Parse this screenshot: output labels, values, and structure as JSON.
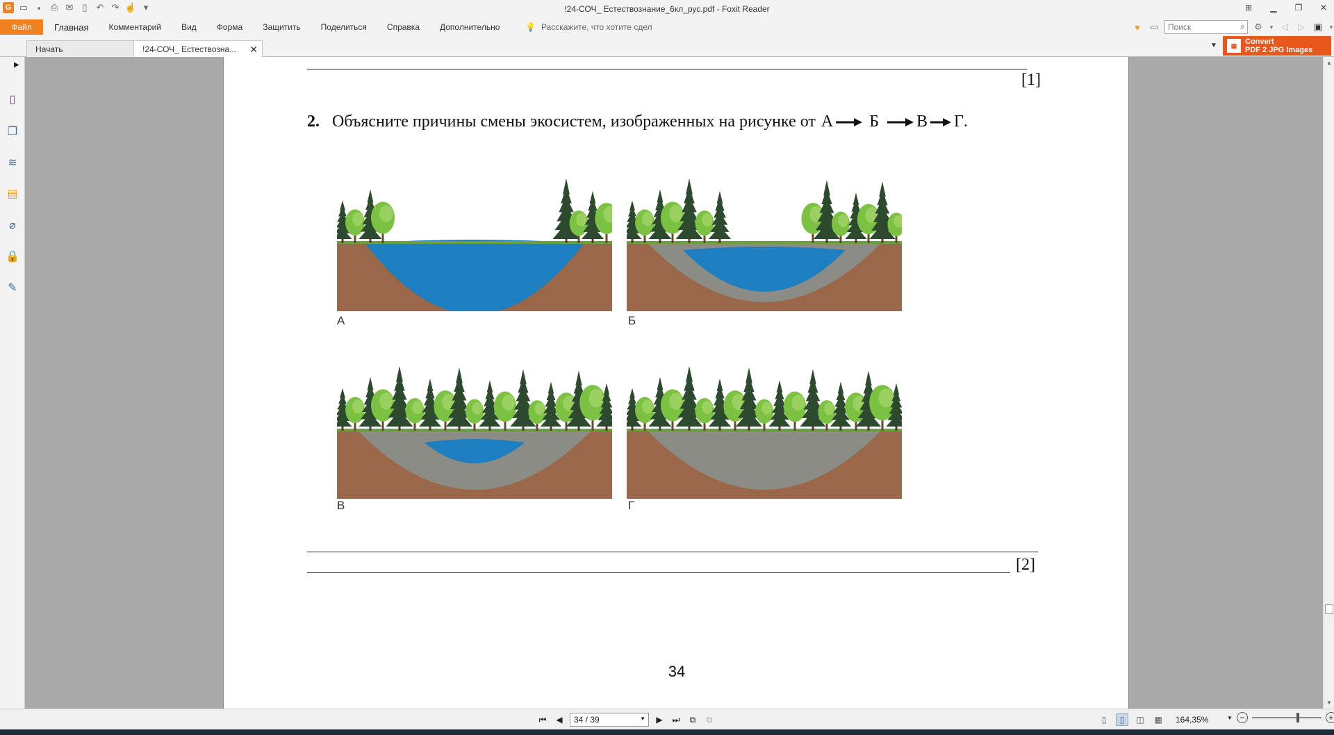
{
  "window": {
    "title": "!24-СОЧ_ Естествознание_6кл_рус.pdf - Foxit Reader",
    "logo": "G"
  },
  "menu": {
    "file": "Файл",
    "items": [
      "Главная",
      "Комментарий",
      "Вид",
      "Форма",
      "Защитить",
      "Поделиться",
      "Справка",
      "Дополнительно"
    ],
    "tell_me": "Расскажите, что хотите сдел",
    "search_placeholder": "Поиск"
  },
  "tabs": [
    {
      "label": "Начать"
    },
    {
      "label": "!24-СОЧ_ Естествозна..."
    }
  ],
  "convert": {
    "line1": "Convert",
    "line2": "PDF 2 JPG Images"
  },
  "document": {
    "score_top": "[1]",
    "question_number": "2.",
    "question_text": "Объясните причины смены экосистем, изображенных на рисунке от",
    "stages": [
      "А",
      "Б",
      "В",
      "Г"
    ],
    "question_end": ".",
    "score_bottom": "[2]",
    "page_number": "34",
    "panels": [
      {
        "label": "А",
        "water_level": 1.0
      },
      {
        "label": "Б",
        "water_level": 0.5
      },
      {
        "label": "В",
        "water_level": 0.15
      },
      {
        "label": "Г",
        "water_level": 0.0
      }
    ]
  },
  "status": {
    "page_field": "34 / 39",
    "zoom": "164,35%"
  },
  "colors": {
    "accent": "#f08020",
    "convert": "#e8581c",
    "water": "#1e7fc0",
    "soil": "#9a6848",
    "silt": "#8c8c86",
    "tree_dark": "#2d4a2e",
    "tree_light": "#7cc242"
  }
}
